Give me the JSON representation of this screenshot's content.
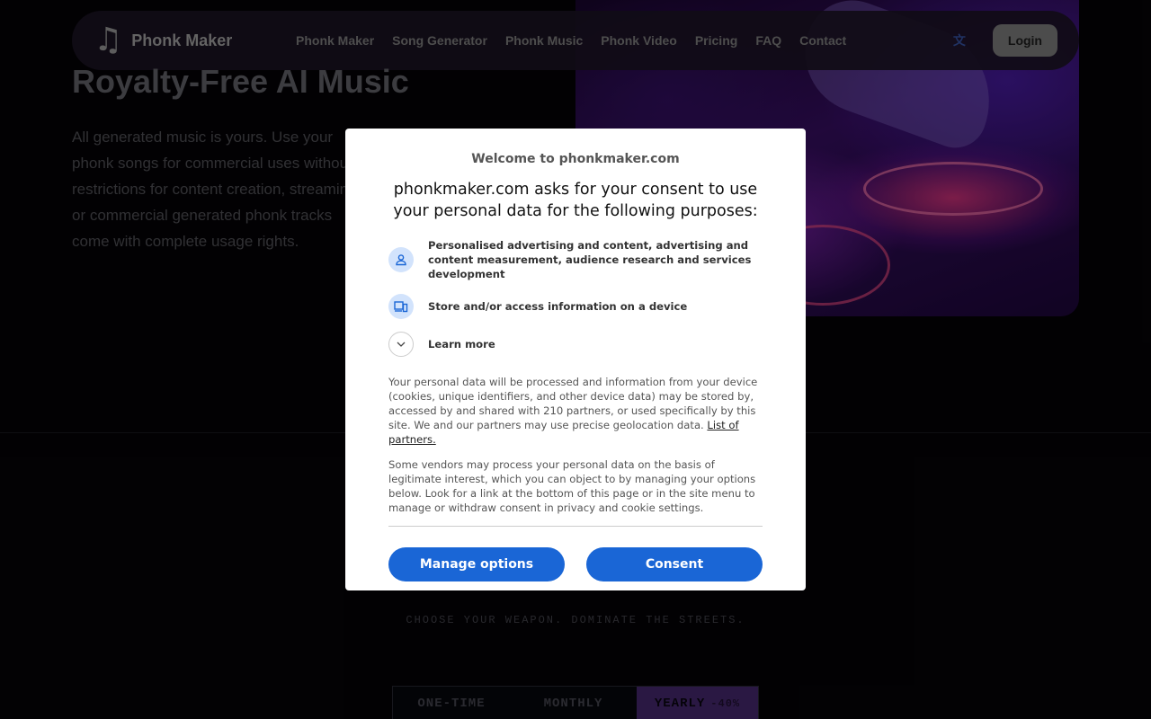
{
  "brand": {
    "name": "Phonk Maker",
    "logo_icon": "music-note-icon"
  },
  "nav": {
    "links": [
      "Phonk Maker",
      "Song Generator",
      "Phonk Music",
      "Phonk Video",
      "Pricing",
      "FAQ",
      "Contact"
    ],
    "language_icon": "translate-icon",
    "login_label": "Login"
  },
  "hero": {
    "title": "Royalty-Free AI Music",
    "description": "All generated music is yours. Use your phonk songs for commercial uses without restrictions for content creation, streaming, or commercial generated phonk tracks come with complete usage rights."
  },
  "pricing": {
    "subtitle": "CHOOSE YOUR WEAPON. DOMINATE THE STREETS.",
    "tabs": {
      "one_time": "ONE-TIME",
      "monthly": "MONTHLY",
      "yearly": "YEARLY",
      "yearly_badge": "-40%"
    }
  },
  "consent": {
    "welcome": "Welcome to phonkmaker.com",
    "heading": "phonkmaker.com asks for your consent to use your personal data for the following purposes:",
    "purposes": [
      {
        "icon": "person-icon",
        "text": "Personalised advertising and content, advertising and content measurement, audience research and services development"
      },
      {
        "icon": "device-icon",
        "text": "Store and/or access information on a device"
      }
    ],
    "learn_more": "Learn more",
    "body_text": "Your personal data will be processed and information from your device (cookies, unique identifiers, and other device data) may be stored by, accessed by and shared with 210 partners, or used specifically by this site. We and our partners may use precise geolocation data.",
    "partners_link": "List of partners.",
    "body_text_2": "Some vendors may process your personal data on the basis of legitimate interest, which you can object to by managing your options below. Look for a link at the bottom of this page or in the site menu to manage or withdraw consent in privacy and cookie settings.",
    "manage_label": "Manage options",
    "consent_label": "Consent",
    "accent": "#1a66d6"
  }
}
